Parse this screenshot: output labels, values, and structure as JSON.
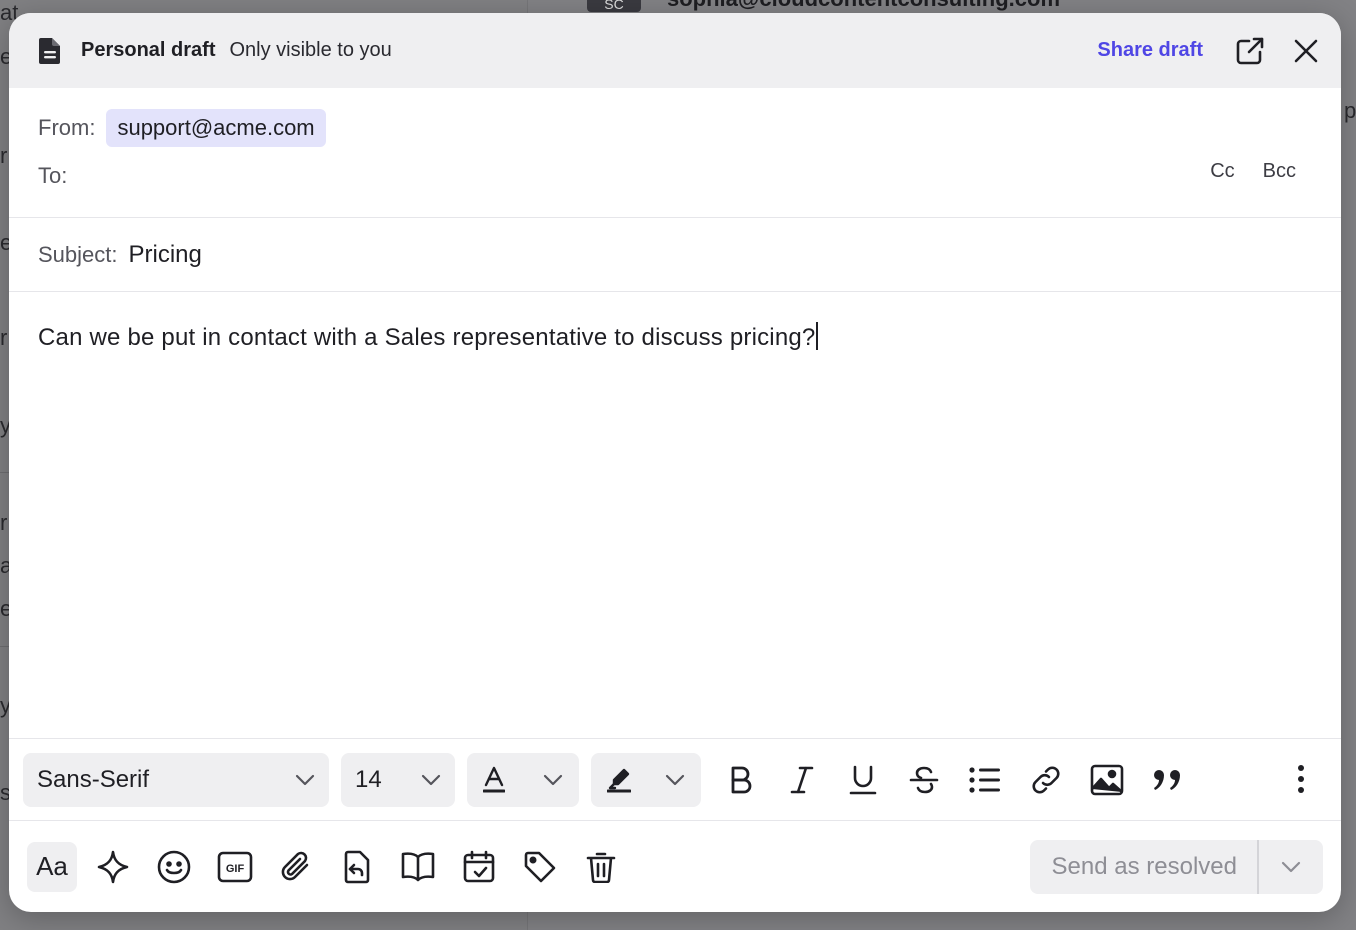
{
  "background": {
    "fragments": [
      "at",
      "e",
      "r",
      "e",
      "r",
      "y",
      "r",
      "a",
      "e",
      "y",
      "s"
    ],
    "avatar": "SC",
    "email": "sophia@cloudcontentconsulting.com",
    "right_fragment": "p"
  },
  "draft_header": {
    "title": "Personal draft",
    "subtitle": "Only visible to you",
    "share_label": "Share draft",
    "icons": {
      "doc": "document-icon",
      "popout": "external-link-icon",
      "close": "close-icon"
    }
  },
  "from": {
    "label": "From:",
    "value": "support@acme.com"
  },
  "to": {
    "label": "To:",
    "value": ""
  },
  "cc_label": "Cc",
  "bcc_label": "Bcc",
  "subject": {
    "label": "Subject:",
    "value": "Pricing"
  },
  "body": {
    "text": "Can we be put in contact with a Sales representative to discuss pricing?"
  },
  "format_bar": {
    "font_family": "Sans-Serif",
    "font_size": "14",
    "tools": [
      "bold-icon",
      "italic-icon",
      "underline-icon",
      "strikethrough-icon",
      "bullet-list-icon",
      "link-icon",
      "image-icon",
      "quote-icon"
    ]
  },
  "action_bar": {
    "format_toggle_label": "Aa",
    "tools": [
      "sparkle-icon",
      "emoji-icon",
      "gif-icon",
      "attachment-icon",
      "reply-template-icon",
      "knowledge-book-icon",
      "schedule-icon",
      "tag-icon",
      "trash-icon"
    ],
    "send_label": "Send as resolved"
  },
  "colors": {
    "accent": "#4f46e5",
    "chip_bg": "#e3e3fb",
    "header_bg": "#efeff1"
  }
}
